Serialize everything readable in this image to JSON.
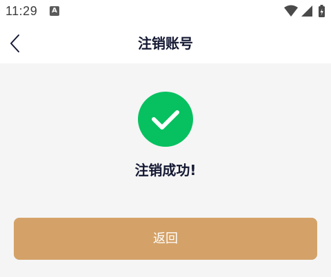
{
  "status_bar": {
    "time": "11:29",
    "notification_icon": "a-icon",
    "notification_label": "A",
    "right_icons": [
      "wifi-icon",
      "signal-icon",
      "battery-charging-icon"
    ]
  },
  "nav": {
    "back_icon": "chevron-left-icon",
    "title": "注销账号"
  },
  "main": {
    "status_icon": "check-circle-icon",
    "status_color": "#07c160",
    "message": "注销成功!",
    "return_button_label": "返回",
    "accent_color": "#d4a268"
  }
}
